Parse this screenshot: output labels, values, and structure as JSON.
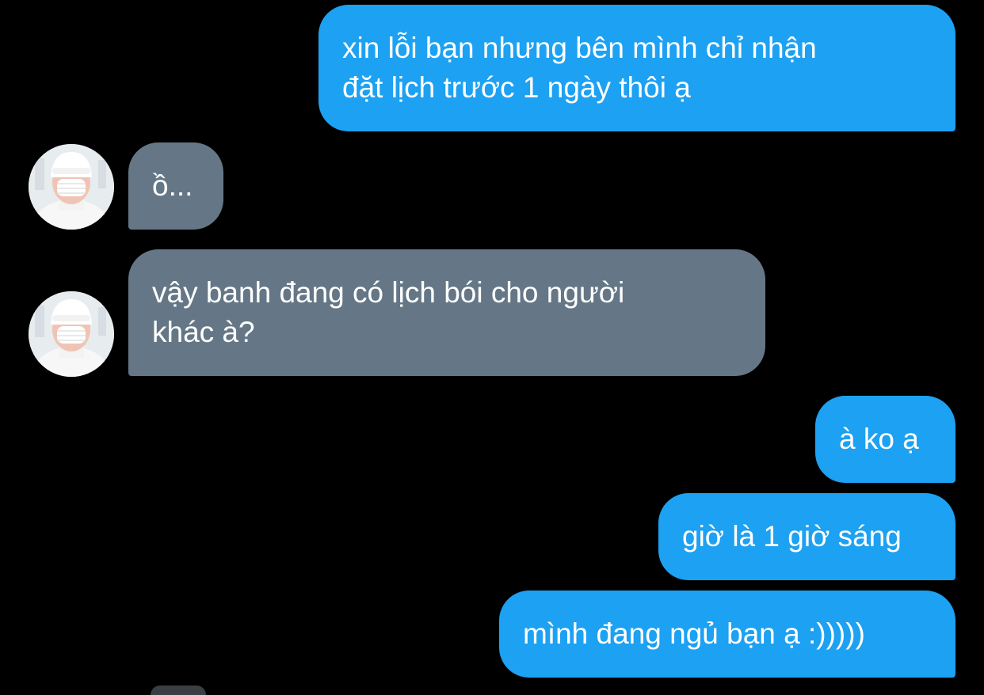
{
  "conversation": {
    "messages": [
      {
        "sender": "me",
        "lines": [
          "xin lỗi bạn nhưng bên mình chỉ nhận",
          "đặt lịch trước 1 ngày thôi ạ"
        ]
      },
      {
        "sender": "other",
        "lines": [
          "ồ..."
        ]
      },
      {
        "sender": "other",
        "lines": [
          "vậy banh đang có lịch bói cho người",
          "khác à?"
        ]
      },
      {
        "sender": "me",
        "lines": [
          "à ko ạ"
        ]
      },
      {
        "sender": "me",
        "lines": [
          "giờ là 1 giờ sáng"
        ]
      },
      {
        "sender": "me",
        "lines": [
          "mình đang ngủ bạn ạ :)))))"
        ]
      }
    ]
  },
  "colors": {
    "background": "#000000",
    "sent_bubble": "#1da1f2",
    "received_bubble": "#657786",
    "text": "#ffffff"
  },
  "icons": {
    "avatar": "user-avatar-icon"
  }
}
